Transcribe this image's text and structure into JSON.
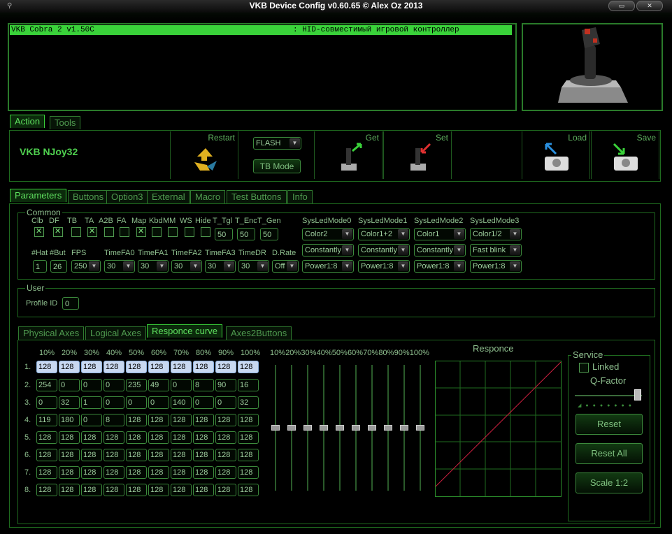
{
  "titlebar": {
    "title": "VKB Device Config v0.60.65 © Alex Oz 2013",
    "minimize_icon": "minimize-icon",
    "close_icon": "close-icon"
  },
  "device_list": {
    "rows": [
      {
        "name": "VKB Cobra 2 v1.50C",
        "desc": ": HID-совместимый игровой контроллер"
      }
    ]
  },
  "top_tabs": [
    "Action",
    "Tools"
  ],
  "action": {
    "device_name": "VKB NJoy32",
    "restart_label": "Restart",
    "flash_value": "FLASH",
    "tb_mode_label": "TB Mode",
    "get_label": "Get",
    "set_label": "Set",
    "load_label": "Load",
    "save_label": "Save"
  },
  "param_tabs": [
    "Parameters",
    "Buttons",
    "Option3",
    "External",
    "Macro",
    "Test Buttons",
    "Info"
  ],
  "common": {
    "group_label": "Common",
    "check_labels": [
      "Clb",
      "DF",
      "TB",
      "TA",
      "A2B",
      "FA",
      "Map",
      "Kbd",
      "MM",
      "WS",
      "Hide"
    ],
    "check_states": [
      true,
      true,
      false,
      true,
      false,
      false,
      true,
      false,
      false,
      false,
      false
    ],
    "t_labels": [
      "T_Tgl",
      "T_Enc",
      "T_Gen"
    ],
    "t_values": [
      "50",
      "50",
      "50"
    ],
    "row2_labels": [
      "#Hat",
      "#But",
      "FPS",
      "TimeFA0",
      "TimeFA1",
      "TimeFA2",
      "TimeFA3",
      "TimeDR",
      "D.Rate"
    ],
    "hat": "1",
    "but": "26",
    "fps": "250",
    "time_values": [
      "30",
      "30",
      "30",
      "30",
      "30"
    ],
    "drate": "Off",
    "sysled": [
      {
        "label": "SysLedMode0",
        "values": [
          "Color2",
          "Constantly",
          "Power1:8"
        ]
      },
      {
        "label": "SysLedMode1",
        "values": [
          "Color1+2",
          "Constantly",
          "Power1:8"
        ]
      },
      {
        "label": "SysLedMode2",
        "values": [
          "Color1",
          "Constantly",
          "Power1:8"
        ]
      },
      {
        "label": "SysLedMode3",
        "values": [
          "Color1/2",
          "Fast blink",
          "Power1:8"
        ]
      }
    ]
  },
  "user": {
    "group_label": "User",
    "profile_label": "Profile ID",
    "profile_value": "0"
  },
  "axes_tabs": [
    "Physical Axes",
    "Logical Axes",
    "Responce curve",
    "Axes2Buttons"
  ],
  "curve": {
    "col_headers": [
      "10%",
      "20%",
      "30%",
      "40%",
      "50%",
      "60%",
      "70%",
      "80%",
      "90%",
      "100%"
    ],
    "row_labels": [
      "1.",
      "2.",
      "3.",
      "4.",
      "5.",
      "6.",
      "7.",
      "8."
    ],
    "rows": [
      [
        "128",
        "128",
        "128",
        "128",
        "128",
        "128",
        "128",
        "128",
        "128",
        "128"
      ],
      [
        "254",
        "0",
        "0",
        "0",
        "235",
        "49",
        "0",
        "8",
        "90",
        "16"
      ],
      [
        "0",
        "32",
        "1",
        "0",
        "0",
        "0",
        "140",
        "0",
        "0",
        "32"
      ],
      [
        "119",
        "180",
        "0",
        "8",
        "128",
        "128",
        "128",
        "128",
        "128",
        "128"
      ],
      [
        "128",
        "128",
        "128",
        "128",
        "128",
        "128",
        "128",
        "128",
        "128",
        "128"
      ],
      [
        "128",
        "128",
        "128",
        "128",
        "128",
        "128",
        "128",
        "128",
        "128",
        "128"
      ],
      [
        "128",
        "128",
        "128",
        "128",
        "128",
        "128",
        "128",
        "128",
        "128",
        "128"
      ],
      [
        "128",
        "128",
        "128",
        "128",
        "128",
        "128",
        "128",
        "128",
        "128",
        "128"
      ]
    ],
    "slider_headers": [
      "10%",
      "20%",
      "30%",
      "40%",
      "50%",
      "60%",
      "70%",
      "80%",
      "90%",
      "100%"
    ],
    "slider_levels": [
      0.5,
      0.5,
      0.5,
      0.5,
      0.5,
      0.5,
      0.5,
      0.5,
      0.5,
      0.5
    ],
    "graph_title": "Responce"
  },
  "service": {
    "group_label": "Service",
    "linked_label": "Linked",
    "qfactor_label": "Q-Factor",
    "qfactor_level": 0.97,
    "reset_label": "Reset",
    "reset_all_label": "Reset All",
    "scale_label": "Scale 1:2"
  },
  "colors": {
    "accent": "#3ad23a",
    "border": "#2a7a2a",
    "curve": "#d02040",
    "grid": "#2a8a2a"
  }
}
